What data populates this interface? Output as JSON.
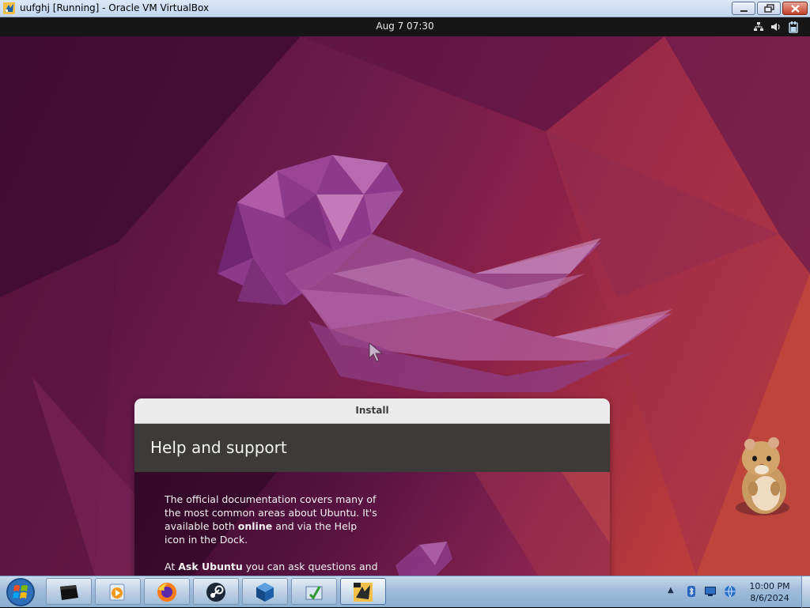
{
  "host_window": {
    "title": "uufghj [Running] - Oracle VM VirtualBox",
    "icons": [
      "virtualbox-icon",
      "minimize-icon",
      "restore-icon",
      "close-icon"
    ]
  },
  "ubuntu_topbar": {
    "clock": "Aug 7  07:30",
    "tray_icons": [
      "network-icon",
      "volume-icon",
      "power-icon"
    ]
  },
  "installer": {
    "window_title": "Install",
    "heading": "Help and support",
    "paragraph1": {
      "before": "The official documentation covers many of the most common areas about Ubuntu. It's available both ",
      "bold": "online",
      "after": " and via the Help icon in the Dock."
    },
    "paragraph2": {
      "before": "At ",
      "bold": "Ask Ubuntu",
      "after": " you can ask questions and"
    }
  },
  "taskbar": {
    "start": "start-orb-icon",
    "items": [
      "terminal-app-icon",
      "media-player-icon",
      "firefox-icon",
      "steam-icon",
      "virtualbox-icon",
      "installer-app-icon",
      "lunar-client-icon"
    ],
    "tray": {
      "chevron": "▲",
      "icons": [
        "bluetooth-icon",
        "display-icon",
        "network-globe-icon"
      ],
      "time": "10:00 PM",
      "date": "8/6/2024"
    }
  },
  "colors": {
    "ubuntu_topbar": "#161616",
    "installer_banner": "#3c3b37",
    "wallpaper_purple": "#6a1b4c",
    "wallpaper_orange": "#c64a38"
  }
}
